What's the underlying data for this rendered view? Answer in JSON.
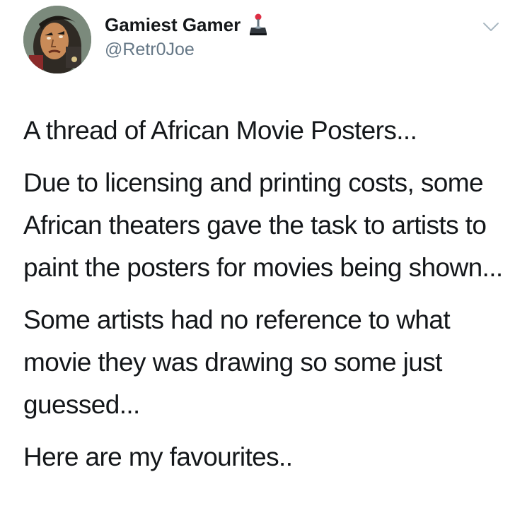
{
  "author": {
    "display_name": "Gamiest Gamer",
    "handle": "@Retr0Joe",
    "name_emoji": "joystick-icon",
    "avatar": "avatar"
  },
  "menu": {
    "icon": "chevron-down-icon"
  },
  "tweet": {
    "paragraphs": [
      "A thread of African Movie Posters...",
      "Due to licensing and printing costs, some African theaters gave the task to artists to paint the posters for movies being shown...",
      "Some artists had no reference to what movie they was drawing so some just guessed...",
      "Here are my favourites.."
    ]
  },
  "colors": {
    "text": "#14171a",
    "secondary": "#657786",
    "background": "#ffffff",
    "chevron": "#aab8c2"
  }
}
